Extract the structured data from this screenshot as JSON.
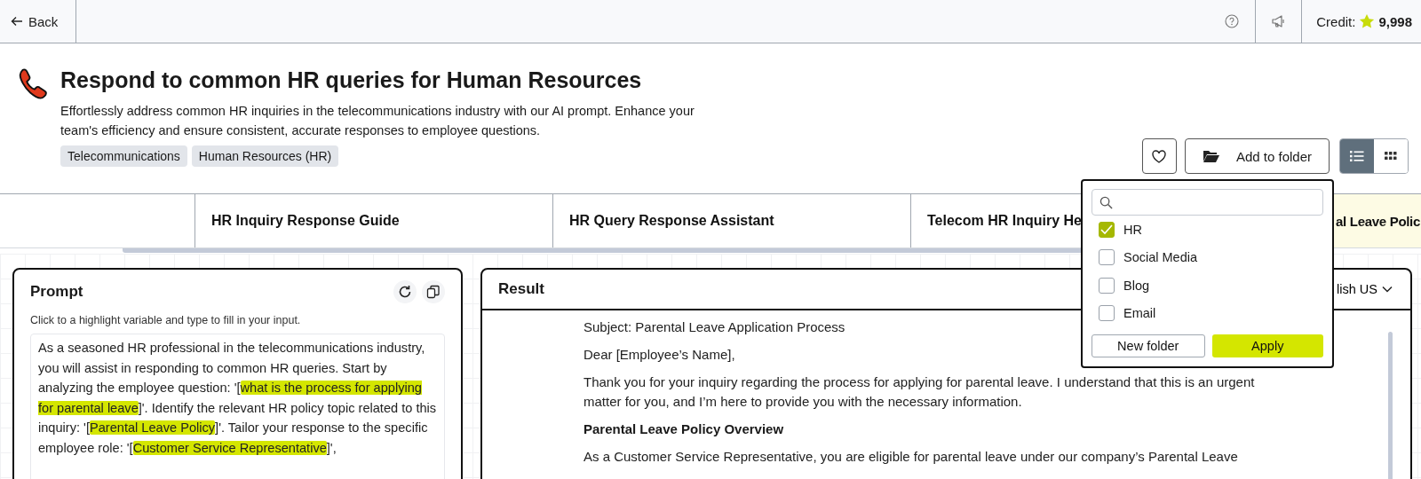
{
  "top_bar": {
    "back": "Back",
    "credit_label": "Credit:",
    "credit_value": "9,998"
  },
  "header": {
    "title": "Respond to common HR queries for Human Resources",
    "description": "Effortlessly address common HR inquiries in the telecommunications industry with our AI prompt. Enhance your team's efficiency and ensure consistent, accurate responses to employee questions.",
    "tags": [
      "Telecommunications",
      "Human Resources (HR)"
    ],
    "add_to_folder": "Add to folder",
    "view_toggle": [
      {
        "kind": "list",
        "selected": true
      },
      {
        "kind": "grid",
        "selected": false
      }
    ]
  },
  "tabs": [
    {
      "label": "HR Inquiry Response Guide",
      "selected": false
    },
    {
      "label": "HR Query Response Assistant",
      "selected": false
    },
    {
      "label": "Telecom HR Inquiry He",
      "selected": false
    },
    {
      "label": "al Leave Polic",
      "selected": true
    }
  ],
  "prompt": {
    "title": "Prompt",
    "hint": "Click to a highlight variable and type to fill in your input.",
    "segments": [
      {
        "text": "As a seasoned HR professional in the telecommunications industry, you will assist in responding to common HR queries. Start by analyzing the employee question: '[",
        "variable": false
      },
      {
        "text": "what is the process for applying for parental leave",
        "variable": true
      },
      {
        "text": "]'. Identify the relevant HR policy topic related to this inquiry: '[",
        "variable": false
      },
      {
        "text": "Parental Leave Policy",
        "variable": true
      },
      {
        "text": "]'. Tailor your response to the specific employee role: '[",
        "variable": false
      },
      {
        "text": "Customer Service Representative",
        "variable": true
      },
      {
        "text": "]',",
        "variable": false
      }
    ]
  },
  "result": {
    "title": "Result",
    "language": "lish US",
    "paragraphs": [
      {
        "kind": "text",
        "text": "Subject: Parental Leave Application Process"
      },
      {
        "kind": "text",
        "text": "Dear [Employee’s Name],"
      },
      {
        "kind": "text",
        "text": "Thank you for your inquiry regarding the process for applying for parental leave. I understand that this is an urgent matter for you, and I’m here to provide you with the necessary information."
      },
      {
        "kind": "heading",
        "text": "Parental Leave Policy Overview"
      },
      {
        "kind": "text",
        "text": "As a Customer Service Representative, you are eligible for parental leave under our company’s Parental Leave"
      }
    ]
  },
  "folder_popup": {
    "folders": [
      {
        "label": "HR",
        "checked": true
      },
      {
        "label": "Social Media",
        "checked": false
      },
      {
        "label": "Blog",
        "checked": false
      },
      {
        "label": "Email",
        "checked": false
      }
    ],
    "new_folder": "New folder",
    "apply": "Apply"
  }
}
